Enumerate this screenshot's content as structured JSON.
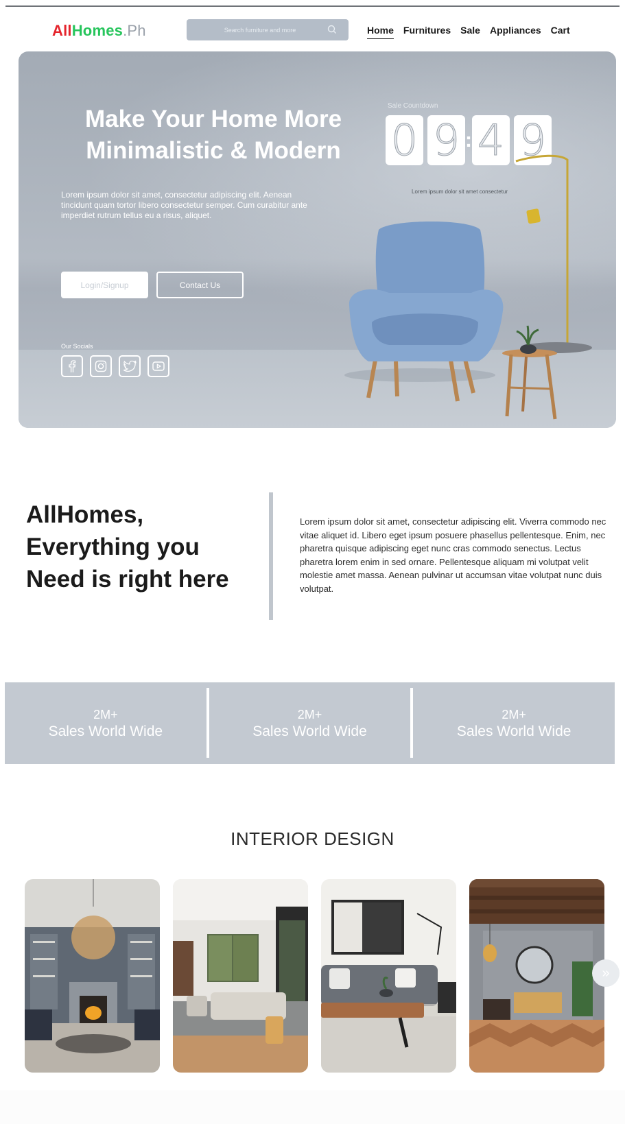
{
  "brand": {
    "logo_part1": "All",
    "logo_part2": "Homes",
    "logo_part3": ".Ph"
  },
  "search": {
    "placeholder": "Search furniture and more"
  },
  "nav": {
    "items": [
      {
        "label": "Home",
        "active": true
      },
      {
        "label": "Furnitures"
      },
      {
        "label": "Sale"
      },
      {
        "label": "Appliances"
      },
      {
        "label": "Cart"
      }
    ]
  },
  "hero": {
    "title": "Make Your Home More Minimalistic & Modern",
    "description": "Lorem ipsum dolor sit amet, consectetur adipiscing elit. Aenean tincidunt quam tortor libero consectetur semper. Cum curabitur ante imperdiet rutrum tellus eu a risus, aliquet.",
    "login_label": "Login/Signup",
    "contact_label": "Contact Us",
    "socials_label": "Our Socials",
    "countdown_label": "Sale Countdown",
    "countdown_digits": [
      "0",
      "9",
      "4",
      "9"
    ],
    "countdown_sub": "Lorem ipsum dolor sit amet consectetur"
  },
  "about": {
    "title": "AllHomes, Everything you Need is right here",
    "text": "Lorem ipsum dolor sit amet, consectetur adipiscing elit. Viverra commodo nec vitae aliquet id. Libero eget ipsum posuere phasellus pellentesque. Enim, nec pharetra quisque adipiscing eget nunc cras commodo senectus. Lectus pharetra lorem enim in sed ornare. Pellentesque aliquam mi volutpat velit molestie amet massa. Aenean pulvinar ut accumsan vitae volutpat nunc duis volutpat."
  },
  "stats": [
    {
      "number": "2M+",
      "label": "Sales World Wide"
    },
    {
      "number": "2M+",
      "label": "Sales World Wide"
    },
    {
      "number": "2M+",
      "label": "Sales World Wide"
    }
  ],
  "interior": {
    "title": "INTERIOR DESIGN",
    "next_icon": "double-chevron-right-icon",
    "next_glyph": "»"
  },
  "colors": {
    "accent_red": "#e5242c",
    "accent_green": "#27c55c",
    "hero_gray": "#a9b0ba",
    "stats_bg": "#c3c9d1",
    "chair_blue": "#7d9ec8"
  }
}
